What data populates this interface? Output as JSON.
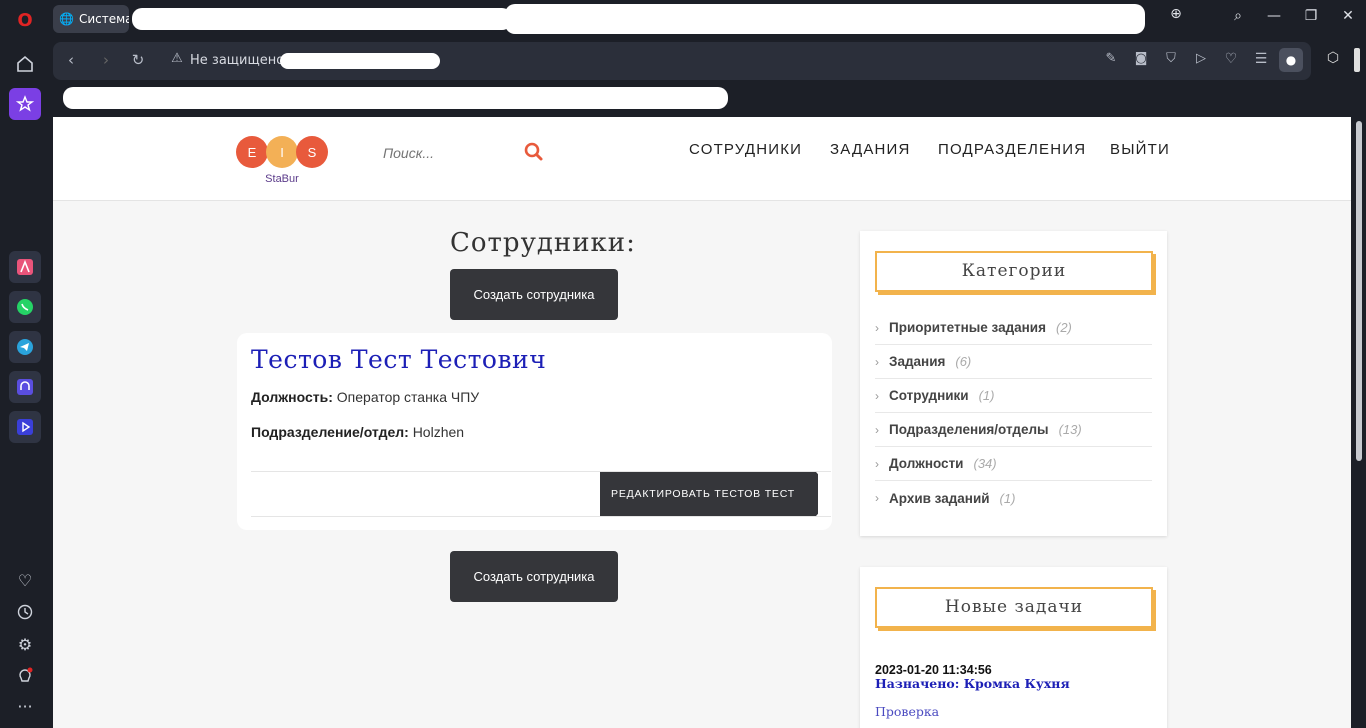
{
  "browser": {
    "tab_title": "Система",
    "security_label": "Не защищено"
  },
  "site": {
    "logo_letters": [
      "E",
      "I",
      "S"
    ],
    "logo_colors": [
      "#e85a3c",
      "#f3b056",
      "#e85a3c"
    ],
    "logo_subtitle": "StaBur",
    "search_placeholder": "Поиск...",
    "nav": [
      "СОТРУДНИКИ",
      "ЗАДАНИЯ",
      "ПОДРАЗДЕЛЕНИЯ",
      "ВЫЙТИ"
    ]
  },
  "main": {
    "page_title": "Сотрудники:",
    "create_button": "Создать сотрудника",
    "employee": {
      "name": "Тестов Тест Тестович",
      "position_label": "Должность:",
      "position_value": "Оператор станка ЧПУ",
      "dept_label": "Подразделение/отдел:",
      "dept_value": "Holzhen",
      "edit_button": "РЕДАКТИРОВАТЬ ТЕСТОВ ТЕСТ"
    }
  },
  "sidebar": {
    "categories_title": "Категории",
    "categories": [
      {
        "label": "Приоритетные задания",
        "count": "(2)"
      },
      {
        "label": "Задания",
        "count": "(6)"
      },
      {
        "label": "Сотрудники",
        "count": "(1)"
      },
      {
        "label": "Подразделения/отделы",
        "count": "(13)"
      },
      {
        "label": "Должности",
        "count": "(34)"
      },
      {
        "label": "Архив заданий",
        "count": "(1)"
      }
    ],
    "new_tasks_title": "Новые задачи",
    "task": {
      "date": "2023-01-20 11:34:56",
      "title": " Назначено:  Кромка Кухня",
      "status": "Проверка"
    }
  },
  "colors": {
    "accent": "#f2b34c",
    "link": "#1c1fb6",
    "dark_button": "#35363a"
  }
}
